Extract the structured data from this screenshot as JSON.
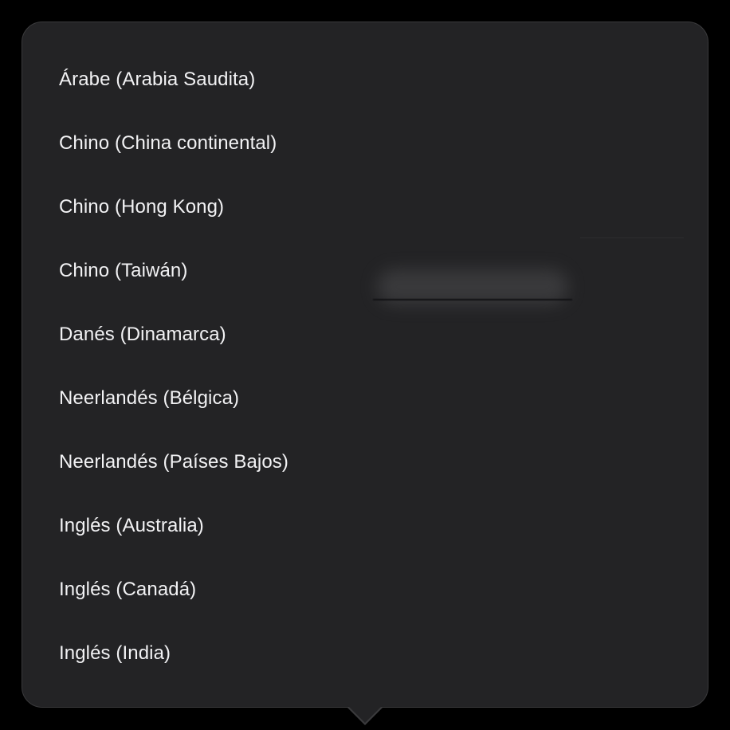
{
  "language_menu": {
    "items": [
      {
        "label": "Árabe (Arabia Saudita)"
      },
      {
        "label": "Chino (China continental)"
      },
      {
        "label": "Chino (Hong Kong)"
      },
      {
        "label": "Chino (Taiwán)"
      },
      {
        "label": "Danés (Dinamarca)"
      },
      {
        "label": "Neerlandés (Bélgica)"
      },
      {
        "label": "Neerlandés (Países Bajos)"
      },
      {
        "label": "Inglés (Australia)"
      },
      {
        "label": "Inglés (Canadá)"
      },
      {
        "label": "Inglés (India)"
      }
    ]
  },
  "colors": {
    "background": "#000000",
    "popover": "#232325",
    "text": "#f2f2f4"
  }
}
